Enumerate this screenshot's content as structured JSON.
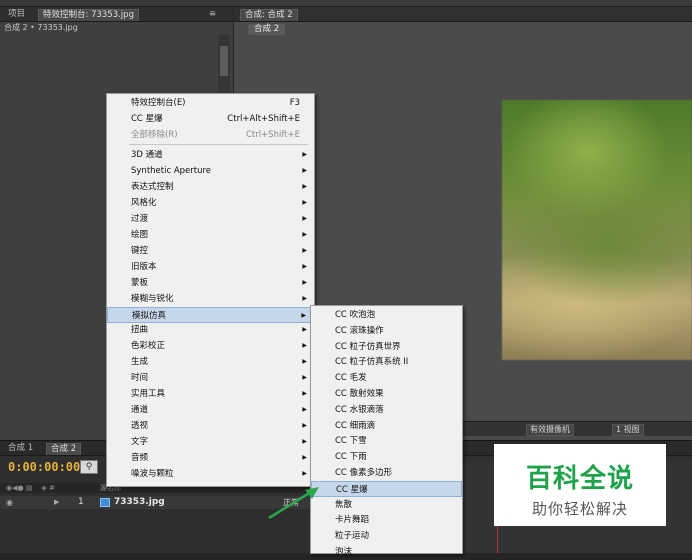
{
  "left_panel": {
    "tabs": [
      {
        "label": "项目"
      },
      {
        "label": "特效控制台: 73353.jpg"
      }
    ],
    "subtitle": "合成 2 • 73353.jpg"
  },
  "viewer": {
    "tab_label": "合成: 合成 2",
    "breadcrumb": "合成 2",
    "bottom": {
      "camera": "有效摄像机",
      "view": "1 视图"
    }
  },
  "timeline": {
    "tabs": [
      {
        "label": "合成 1"
      },
      {
        "label": "合成 2"
      }
    ],
    "timecode": "0:00:00:00",
    "header_text": "源名称",
    "layer": {
      "number": "1",
      "name": "73353.jpg",
      "mode": "正常"
    }
  },
  "main_menu": {
    "items": [
      {
        "label": "特效控制台(E)",
        "shortcut": "F3"
      },
      {
        "label": "CC 星爆",
        "shortcut": "Ctrl+Alt+Shift+E"
      },
      {
        "label": "全部移除(R)",
        "shortcut": "Ctrl+Shift+E",
        "disabled": true
      },
      {
        "label": "3D 通道",
        "submenu": true
      },
      {
        "label": "Synthetic Aperture",
        "submenu": true
      },
      {
        "label": "表达式控制",
        "submenu": true
      },
      {
        "label": "风格化",
        "submenu": true
      },
      {
        "label": "过渡",
        "submenu": true
      },
      {
        "label": "绘图",
        "submenu": true
      },
      {
        "label": "键控",
        "submenu": true
      },
      {
        "label": "旧版本",
        "submenu": true
      },
      {
        "label": "蒙板",
        "submenu": true
      },
      {
        "label": "模糊与锐化",
        "submenu": true
      },
      {
        "label": "模拟仿真",
        "submenu": true,
        "highlighted": true
      },
      {
        "label": "扭曲",
        "submenu": true
      },
      {
        "label": "色彩校正",
        "submenu": true
      },
      {
        "label": "生成",
        "submenu": true
      },
      {
        "label": "时间",
        "submenu": true
      },
      {
        "label": "实用工具",
        "submenu": true
      },
      {
        "label": "通道",
        "submenu": true
      },
      {
        "label": "透视",
        "submenu": true
      },
      {
        "label": "文字",
        "submenu": true
      },
      {
        "label": "音频",
        "submenu": true
      },
      {
        "label": "噪波与颗粒",
        "submenu": true
      }
    ]
  },
  "sub_menu": {
    "items": [
      {
        "label": "CC 吹泡泡"
      },
      {
        "label": "CC 滚珠操作"
      },
      {
        "label": "CC 粒子仿真世界"
      },
      {
        "label": "CC 粒子仿真系统 II"
      },
      {
        "label": "CC 毛发"
      },
      {
        "label": "CC 散射效果"
      },
      {
        "label": "CC 水银滴落"
      },
      {
        "label": "CC 细雨滴"
      },
      {
        "label": "CC 下雪"
      },
      {
        "label": "CC 下雨"
      },
      {
        "label": "CC 像素多边形"
      },
      {
        "label": "CC 星爆",
        "highlighted": true
      },
      {
        "label": "焦散"
      },
      {
        "label": "卡片舞蹈"
      },
      {
        "label": "粒子运动"
      },
      {
        "label": "泡沫"
      }
    ]
  },
  "watermark": {
    "title": "百科全说",
    "subtitle": "助你轻松解决"
  },
  "colors": {
    "timecode": "#e6b23a",
    "highlight": "#c6d7ec",
    "watermark_green": "#1ea34a"
  }
}
